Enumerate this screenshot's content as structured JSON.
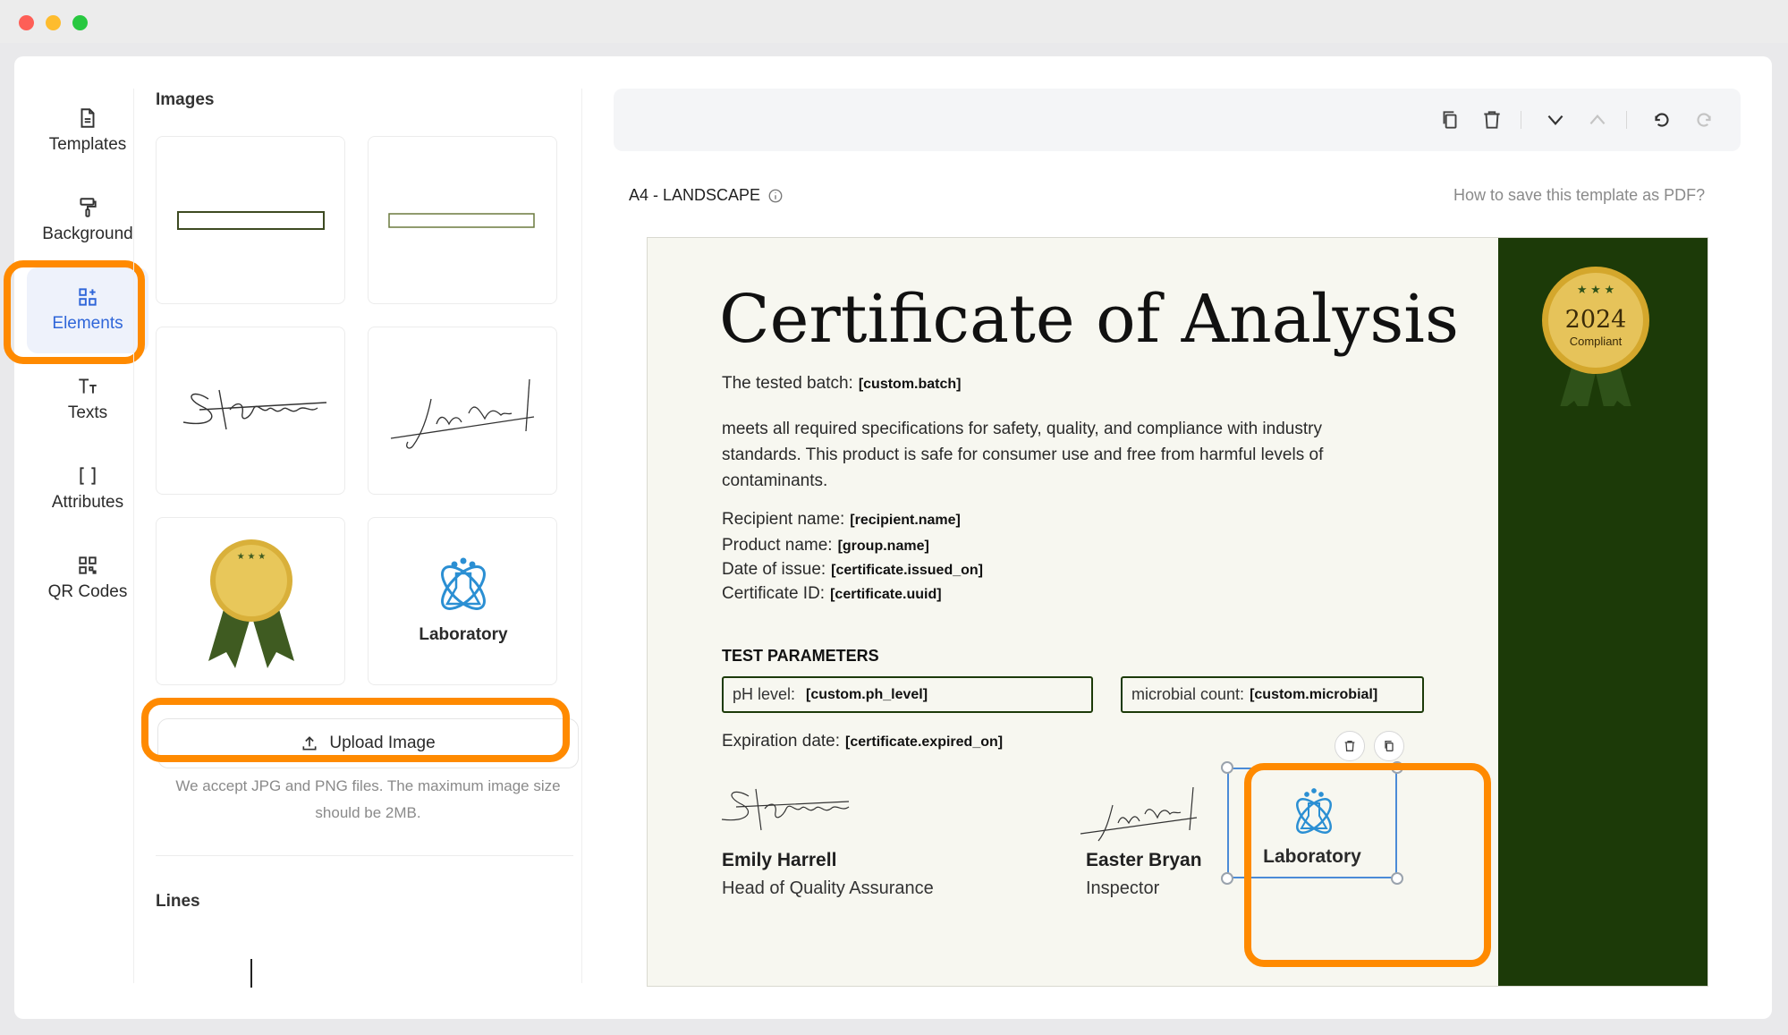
{
  "window": {
    "controls": [
      "close",
      "minimize",
      "maximize"
    ]
  },
  "nav": {
    "items": [
      {
        "label": "Templates",
        "icon": "file-icon"
      },
      {
        "label": "Background",
        "icon": "paint-roller-icon"
      },
      {
        "label": "Elements",
        "icon": "elements-grid-icon",
        "active": true
      },
      {
        "label": "Texts",
        "icon": "text-size-icon"
      },
      {
        "label": "Attributes",
        "icon": "brackets-icon"
      },
      {
        "label": "QR Codes",
        "icon": "qr-code-icon"
      }
    ]
  },
  "panel": {
    "images_title": "Images",
    "image_cards": [
      {
        "name": "frame-thick-border"
      },
      {
        "name": "frame-thin-border"
      },
      {
        "name": "signature-steven"
      },
      {
        "name": "signature-john-james"
      },
      {
        "name": "gold-medal-ribbon"
      },
      {
        "name": "laboratory-logo",
        "label": "Laboratory"
      }
    ],
    "upload_label": "Upload Image",
    "upload_note": "We accept JPG and PNG files. The maximum image size should be 2MB.",
    "lines_title": "Lines"
  },
  "toolbar": {
    "icons": [
      "copy-icon",
      "trash-icon",
      "chevron-down-icon",
      "chevron-up-icon",
      "undo-icon",
      "redo-icon"
    ]
  },
  "page": {
    "format": "A4 - LANDSCAPE",
    "help_link": "How to save this template as PDF?"
  },
  "certificate": {
    "title": "Certificate of Analysis",
    "batch_label": "The tested batch:",
    "batch_tag": "[custom.batch]",
    "body": "meets all required specifications for safety, quality, and compliance with industry standards. This product is safe for consumer use and free from harmful levels of contaminants.",
    "fields": [
      {
        "label": "Recipient name:",
        "tag": "[recipient.name]"
      },
      {
        "label": "Product name:",
        "tag": "[group.name]"
      },
      {
        "label": "Date of issue:",
        "tag": "[certificate.issued_on]"
      },
      {
        "label": "Certificate ID:",
        "tag": "[certificate.uuid]"
      }
    ],
    "params_title": "TEST PARAMETERS",
    "params": [
      {
        "label": "pH level:",
        "tag": "[custom.ph_level]"
      },
      {
        "label": "microbial count:",
        "tag": "[custom.microbial]"
      }
    ],
    "expiration_label": "Expiration date:",
    "expiration_tag": "[certificate.expired_on]",
    "signers": [
      {
        "name": "Emily Harrell",
        "role": "Head of Quality Assurance"
      },
      {
        "name": "Easter Bryan",
        "role": "Inspector"
      }
    ],
    "logo_label": "Laboratory",
    "medal": {
      "year": "2024",
      "text": "Compliant"
    },
    "colors": {
      "band": "#1c3a08",
      "gold": "#d4a72c",
      "selection": "#4b8bd7",
      "highlight": "#ff8a00"
    }
  }
}
